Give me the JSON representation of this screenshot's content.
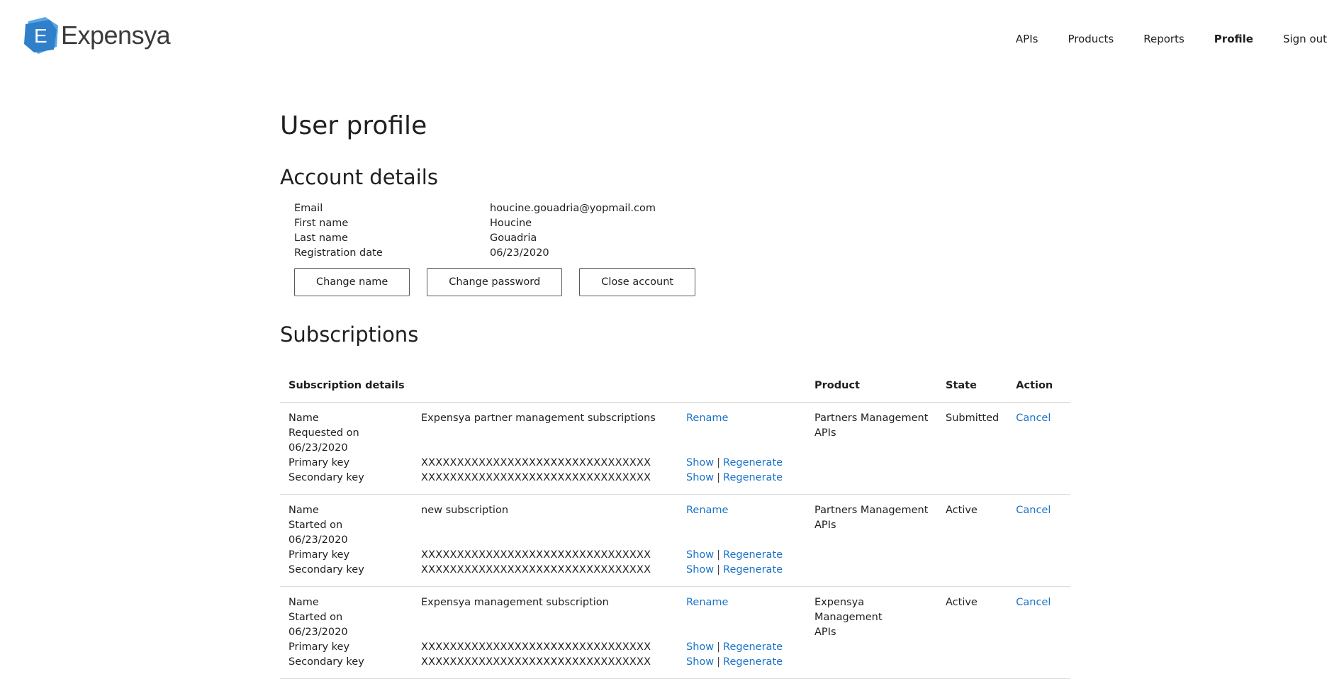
{
  "brand": {
    "name": "Expensya",
    "mark_letter": "E",
    "colors": {
      "logo_blue": "#2f7fcb",
      "logo_light": "#5aa6e6",
      "link": "#1a73c8"
    }
  },
  "nav": {
    "items": [
      {
        "label": "APIs",
        "active": false
      },
      {
        "label": "Products",
        "active": false
      },
      {
        "label": "Reports",
        "active": false
      },
      {
        "label": "Profile",
        "active": true
      },
      {
        "label": "Sign out",
        "active": false
      }
    ]
  },
  "page": {
    "title": "User profile"
  },
  "account": {
    "title": "Account details",
    "fields": [
      {
        "label": "Email",
        "value": "houcine.gouadria@yopmail.com"
      },
      {
        "label": "First name",
        "value": "Houcine"
      },
      {
        "label": "Last name",
        "value": "Gouadria"
      },
      {
        "label": "Registration date",
        "value": "06/23/2020"
      }
    ],
    "buttons": {
      "change_name": "Change name",
      "change_password": "Change password",
      "close_account": "Close account"
    }
  },
  "subscriptions": {
    "title": "Subscriptions",
    "headers": {
      "details": "Subscription details",
      "product": "Product",
      "state": "State",
      "action": "Action"
    },
    "labels": {
      "name": "Name",
      "primary_key": "Primary key",
      "secondary_key": "Secondary key",
      "rename": "Rename",
      "show": "Show",
      "regenerate": "Regenerate",
      "separator": "|"
    },
    "rows": [
      {
        "name": "Expensya partner management subscriptions",
        "date_label": "Requested on",
        "date": "06/23/2020",
        "primary_key": "XXXXXXXXXXXXXXXXXXXXXXXXXXXXXXXX",
        "secondary_key": "XXXXXXXXXXXXXXXXXXXXXXXXXXXXXXXX",
        "product_line1": "Partners Management",
        "product_line2": "APIs",
        "state": "Submitted",
        "action": "Cancel"
      },
      {
        "name": "new subscription",
        "date_label": "Started on",
        "date": "06/23/2020",
        "primary_key": "XXXXXXXXXXXXXXXXXXXXXXXXXXXXXXXX",
        "secondary_key": "XXXXXXXXXXXXXXXXXXXXXXXXXXXXXXXX",
        "product_line1": "Partners Management",
        "product_line2": "APIs",
        "state": "Active",
        "action": "Cancel"
      },
      {
        "name": "Expensya management subscription",
        "date_label": "Started on",
        "date": "06/23/2020",
        "primary_key": "XXXXXXXXXXXXXXXXXXXXXXXXXXXXXXXX",
        "secondary_key": "XXXXXXXXXXXXXXXXXXXXXXXXXXXXXXXX",
        "product_line1": "Expensya Management",
        "product_line2": "APIs",
        "state": "Active",
        "action": "Cancel"
      }
    ]
  }
}
